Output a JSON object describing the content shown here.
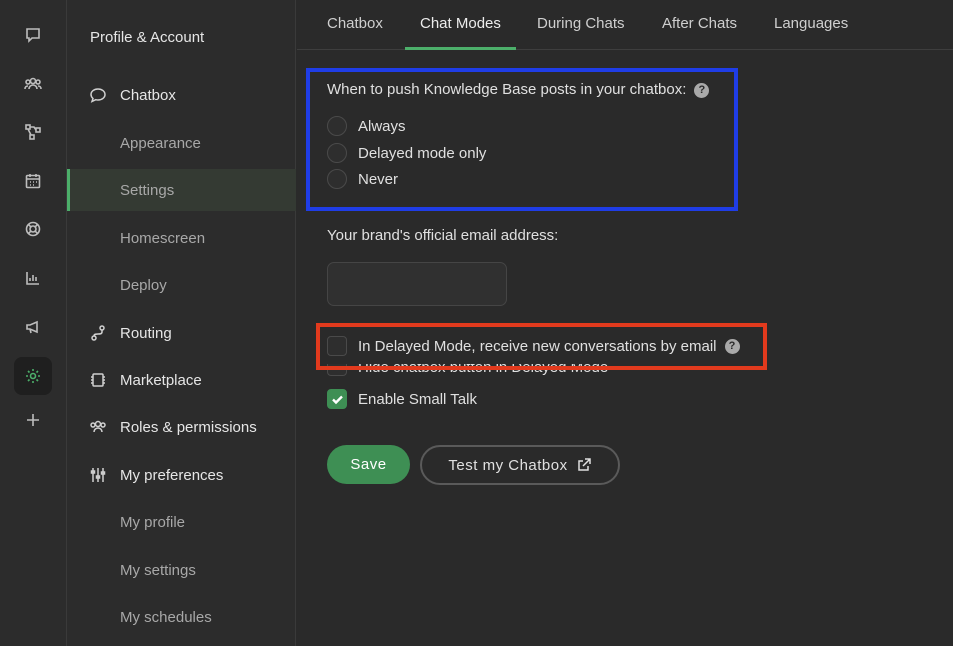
{
  "rail": {
    "icons": [
      "chat-icon",
      "team-icon",
      "workflow-icon",
      "calendar-icon",
      "lifebuoy-icon",
      "chart-icon",
      "megaphone-icon",
      "settings-icon",
      "plus-icon"
    ]
  },
  "sidebar": {
    "profile_account": "Profile & Account",
    "chatbox": "Chatbox",
    "appearance": "Appearance",
    "settings": "Settings",
    "homescreen": "Homescreen",
    "deploy": "Deploy",
    "routing": "Routing",
    "marketplace": "Marketplace",
    "roles_permissions": "Roles & permissions",
    "my_preferences": "My preferences",
    "my_profile": "My profile",
    "my_settings": "My settings",
    "my_schedules": "My schedules"
  },
  "tabs": {
    "chatbox": "Chatbox",
    "chat_modes": "Chat Modes",
    "during_chats": "During Chats",
    "after_chats": "After Chats",
    "languages": "Languages"
  },
  "kb": {
    "question": "When to push Knowledge Base posts in your chatbox:",
    "help": "?",
    "options": [
      "Always",
      "Delayed mode only",
      "Never"
    ]
  },
  "email": {
    "label": "Your brand's official email address:",
    "value": ""
  },
  "checks": {
    "delayed_email": "In Delayed Mode, receive new conversations by email",
    "hide_button": "Hide chatbox button in Delayed Mode",
    "small_talk": "Enable Small Talk",
    "help": "?"
  },
  "actions": {
    "save": "Save",
    "test": "Test my Chatbox"
  },
  "colors": {
    "accent": "#4caf6a",
    "highlight_blue": "#1f3de6",
    "highlight_red": "#e23a1d"
  }
}
